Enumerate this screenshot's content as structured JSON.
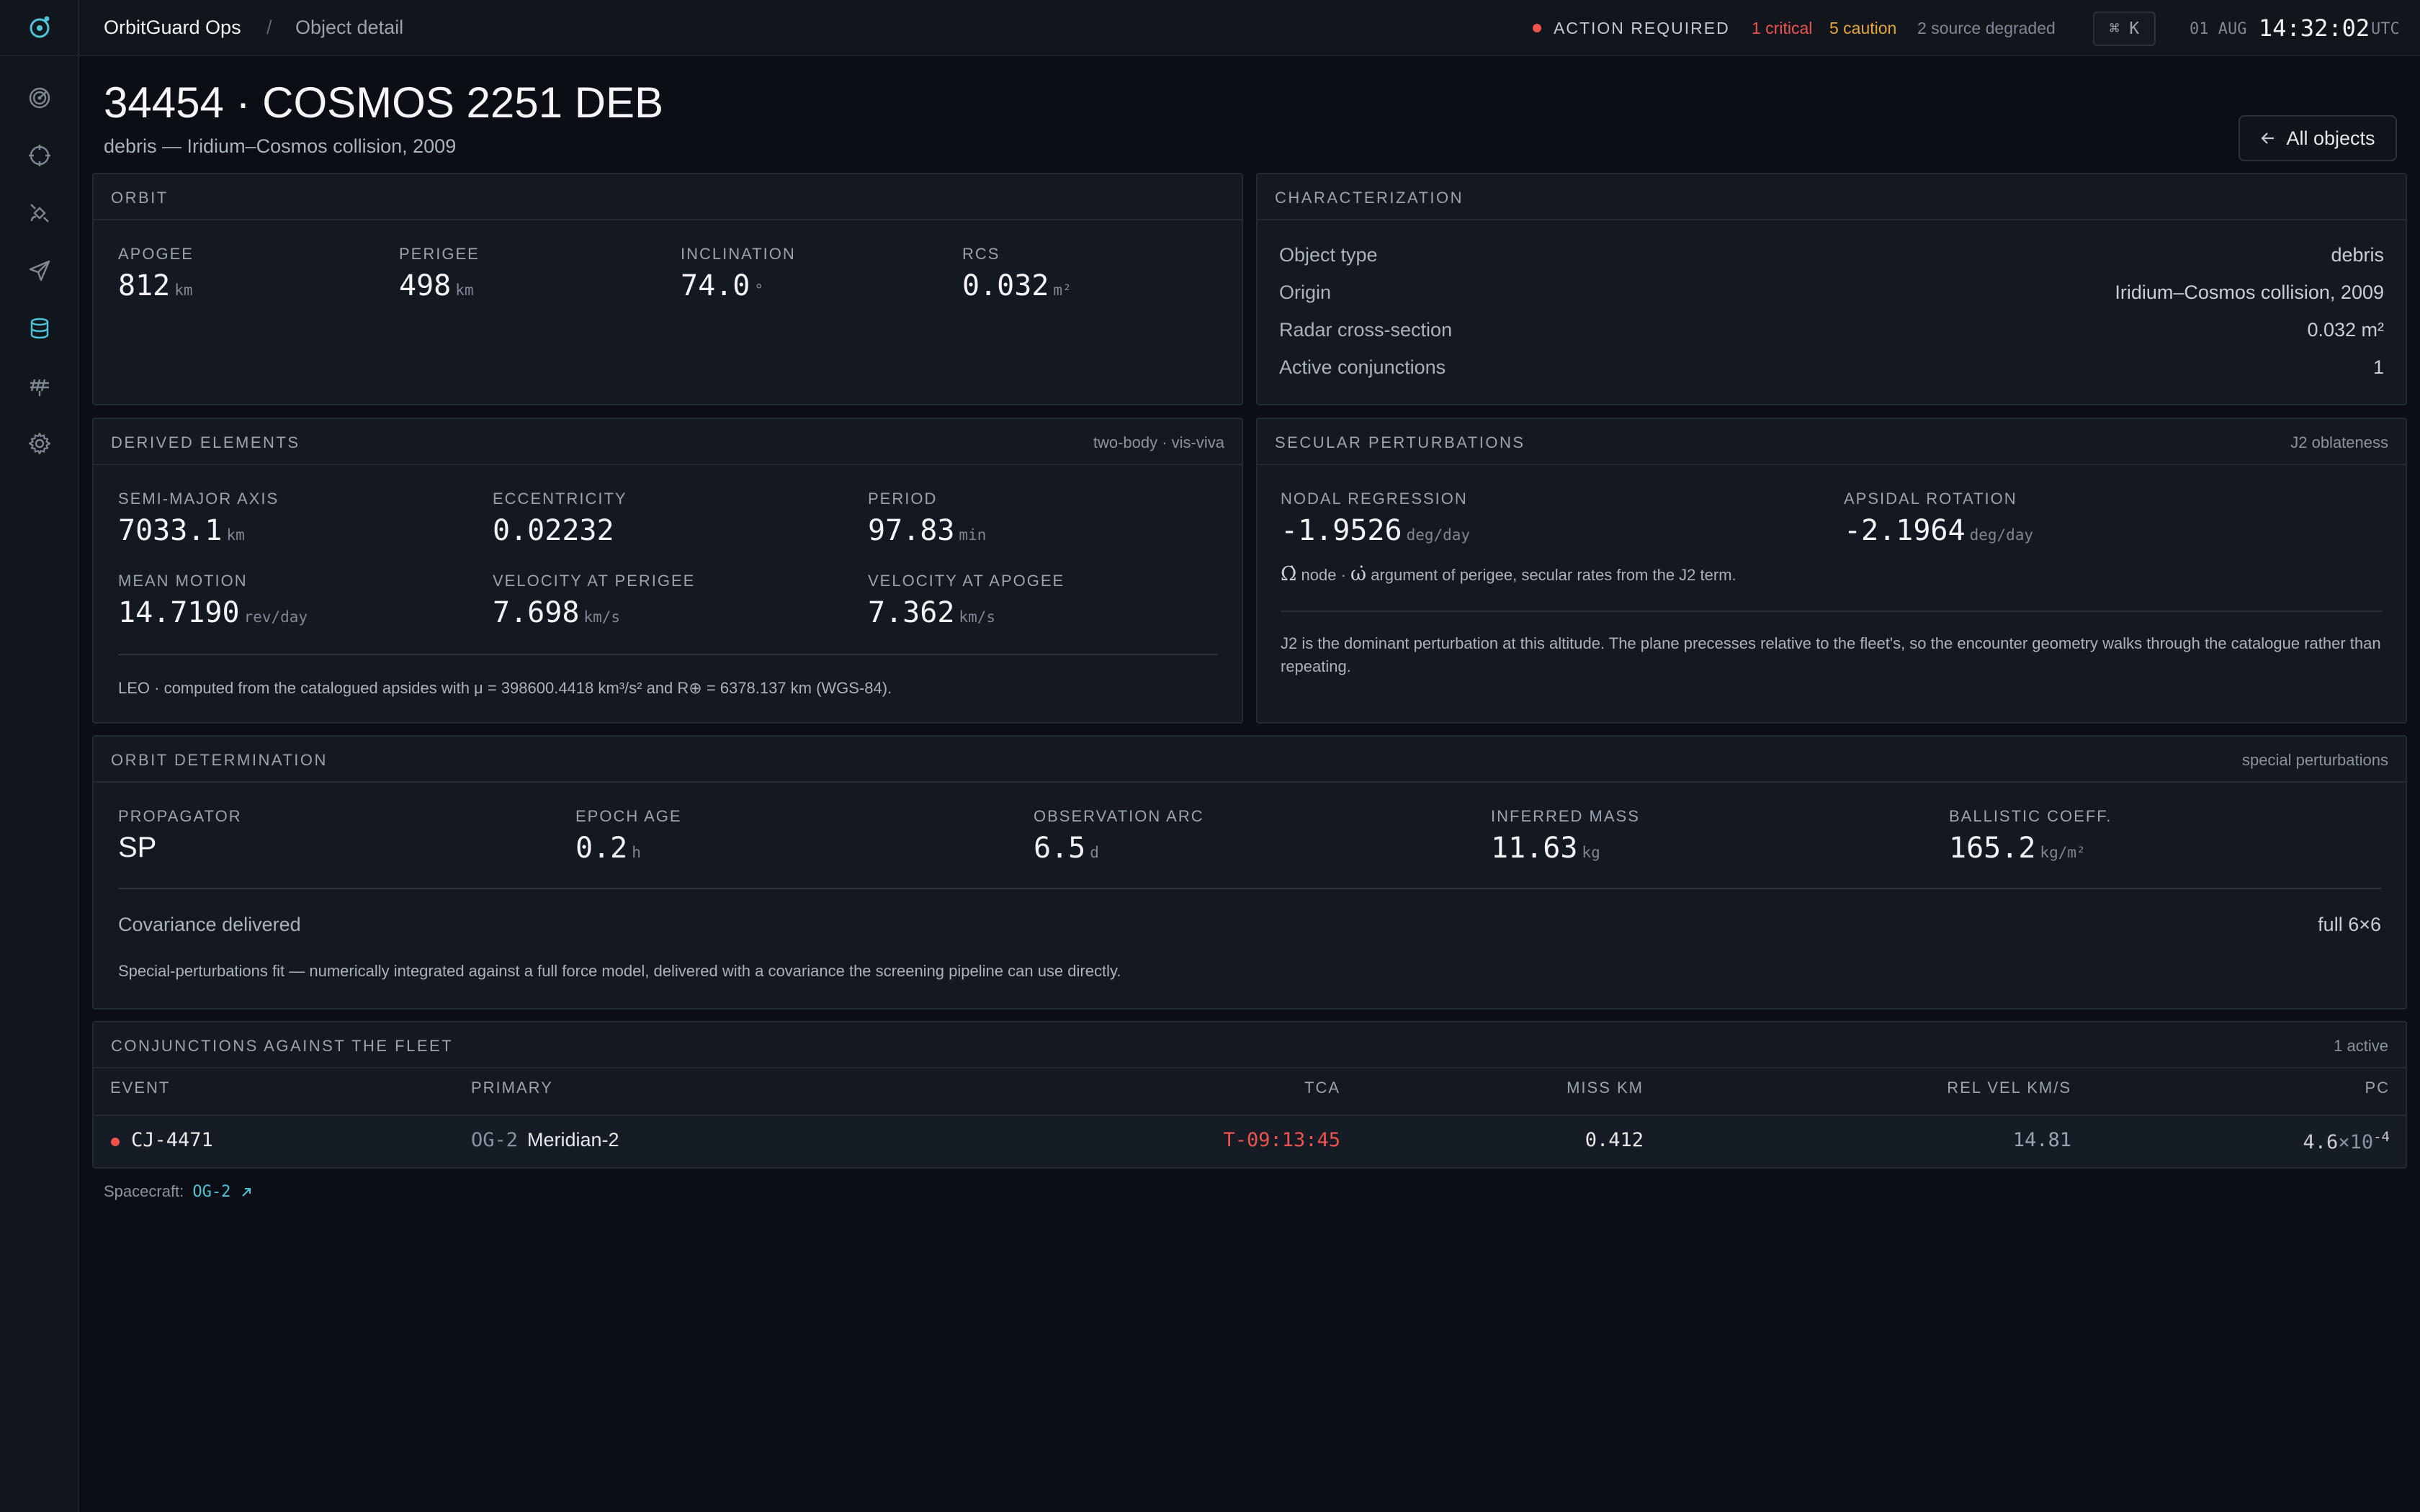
{
  "app": {
    "name": "OrbitGuard Ops",
    "breadcrumb_sep": "/",
    "page": "Object detail"
  },
  "sidebar": {
    "items": [
      {
        "icon": "radar-icon",
        "label": ""
      },
      {
        "icon": "crosshair-icon",
        "label": ""
      },
      {
        "icon": "satellite-icon",
        "label": ""
      },
      {
        "icon": "send-icon",
        "label": ""
      },
      {
        "icon": "database-icon",
        "label": "",
        "active": true
      },
      {
        "icon": "antenna-icon",
        "label": ""
      },
      {
        "icon": "gear-icon",
        "label": ""
      }
    ]
  },
  "status": {
    "label": "ACTION REQUIRED",
    "critical": "1 critical",
    "caution": "5 caution",
    "degraded": "2 source degraded",
    "shortcut": "⌘ K",
    "date": "01 AUG",
    "time": "14:32:02",
    "tz": "UTC",
    "colors": {
      "critical": "#f0524d",
      "caution": "#e7a53a",
      "accent": "#4fc3d9"
    }
  },
  "header": {
    "title": "34454 · COSMOS 2251 DEB",
    "subtitle": "debris — Iridium–Cosmos collision, 2009",
    "back_label": "All objects"
  },
  "orbit": {
    "title": "ORBIT",
    "stats": [
      {
        "label": "APOGEE",
        "value": "812",
        "unit": "km"
      },
      {
        "label": "PERIGEE",
        "value": "498",
        "unit": "km"
      },
      {
        "label": "INCLINATION",
        "value": "74.0",
        "unit": "°"
      },
      {
        "label": "RCS",
        "value": "0.032",
        "unit": "m²"
      }
    ]
  },
  "characterization": {
    "title": "CHARACTERIZATION",
    "rows": [
      {
        "k": "Object type",
        "v": "debris"
      },
      {
        "k": "Origin",
        "v": "Iridium–Cosmos collision, 2009"
      },
      {
        "k": "Radar cross-section",
        "v": "0.032 m²"
      },
      {
        "k": "Active conjunctions",
        "v": "1"
      }
    ]
  },
  "derived": {
    "title": "DERIVED ELEMENTS",
    "note": "two-body · vis-viva",
    "stats": [
      {
        "label": "SEMI-MAJOR AXIS",
        "value": "7033.1",
        "unit": "km"
      },
      {
        "label": "ECCENTRICITY",
        "value": "0.02232",
        "unit": ""
      },
      {
        "label": "PERIOD",
        "value": "97.83",
        "unit": "min"
      },
      {
        "label": "MEAN MOTION",
        "value": "14.7190",
        "unit": "rev/day"
      },
      {
        "label": "VELOCITY AT PERIGEE",
        "value": "7.698",
        "unit": "km/s"
      },
      {
        "label": "VELOCITY AT APOGEE",
        "value": "7.362",
        "unit": "km/s"
      }
    ],
    "footnote": "LEO · computed from the catalogued apsides with μ = 398600.4418 km³/s² and R⊕ = 6378.137 km (WGS-84)."
  },
  "secular": {
    "title": "SECULAR PERTURBATIONS",
    "note": "J2 oblateness",
    "stats": [
      {
        "label": "NODAL REGRESSION",
        "value": "-1.9526",
        "unit": "deg/day"
      },
      {
        "label": "APSIDAL ROTATION",
        "value": "-2.1964",
        "unit": "deg/day"
      }
    ],
    "legend_sym1": "Ω̇",
    "legend_txt1": "node ·",
    "legend_sym2": "ω̇",
    "legend_txt2": "argument of perigee, secular rates from the J2 term.",
    "paragraph": "J2 is the dominant perturbation at this altitude. The plane precesses relative to the fleet's, so the encounter geometry walks through the catalogue rather than repeating."
  },
  "od": {
    "title": "ORBIT DETERMINATION",
    "note": "special perturbations",
    "stats": [
      {
        "label": "PROPAGATOR",
        "value": "SP",
        "unit": ""
      },
      {
        "label": "EPOCH AGE",
        "value": "0.2",
        "unit": "h"
      },
      {
        "label": "OBSERVATION ARC",
        "value": "6.5",
        "unit": "d"
      },
      {
        "label": "INFERRED MASS",
        "value": "11.63",
        "unit": "kg"
      },
      {
        "label": "BALLISTIC COEFF.",
        "value": "165.2",
        "unit": "kg/m²"
      }
    ],
    "cov_label": "Covariance delivered",
    "cov_value": "full 6×6",
    "paragraph": "Special-perturbations fit — numerically integrated against a full force model, delivered with a covariance the screening pipeline can use directly."
  },
  "conjunctions": {
    "title": "CONJUNCTIONS AGAINST THE FLEET",
    "note": "1 active",
    "columns": [
      "EVENT",
      "PRIMARY",
      "TCA",
      "MISS KM",
      "REL VEL KM/S",
      "PC"
    ],
    "rows": [
      {
        "event": "CJ-4471",
        "primary_id": "OG-2",
        "primary_name": "Meridian-2",
        "tca": "T-09:13:45",
        "miss": "0.412",
        "relvel": "14.81",
        "pc_mant": "4.6",
        "pc_base": "×10",
        "pc_exp": "-4"
      }
    ]
  },
  "footer": {
    "label": "Spacecraft:",
    "link": "OG-2"
  }
}
